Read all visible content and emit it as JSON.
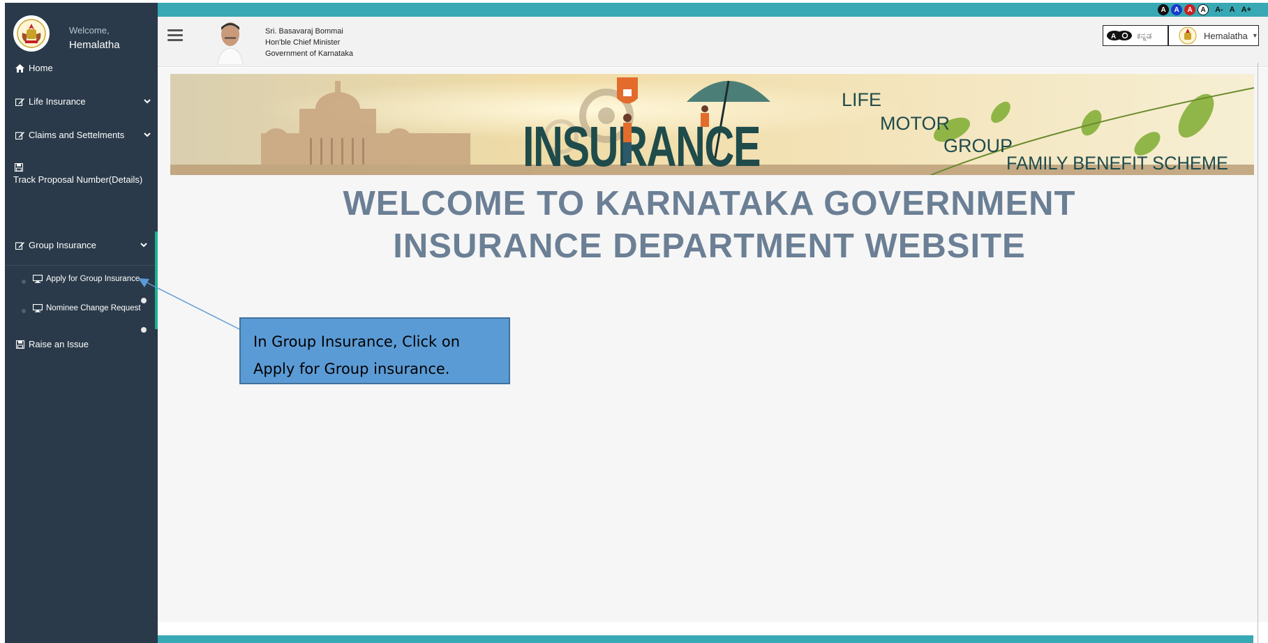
{
  "sidebar": {
    "welcome": "Welcome,",
    "username": "Hemalatha",
    "items": [
      {
        "label": "Home"
      },
      {
        "label": "Life Insurance"
      },
      {
        "label": "Claims and Settelments"
      },
      {
        "label": "Track Proposal Number(Details)"
      },
      {
        "label": "Group Insurance"
      },
      {
        "label": "Raise an Issue"
      }
    ],
    "group_sub": [
      {
        "label": "Apply for Group Insurance"
      },
      {
        "label": "Nominee Change Request"
      }
    ]
  },
  "header": {
    "cm_name": "Sri. Basavaraj Bommai",
    "cm_title": "Hon'ble Chief Minister",
    "cm_gov": "Government of Karnataka",
    "access": [
      "A",
      "A",
      "A",
      "A"
    ],
    "font_sizes": [
      "A-",
      "A",
      "A+"
    ],
    "language": "ಕನ್ನಡ",
    "user": "Hemalatha"
  },
  "banner": {
    "main_word": "INSURANCE",
    "life": "LIFE",
    "motor": "MOTOR",
    "group": "GROUP",
    "family": "FAMILY BENEFIT SCHEME"
  },
  "main": {
    "title_line1": "WELCOME TO KARNATAKA GOVERNMENT",
    "title_line2": "INSURANCE DEPARTMENT WEBSITE"
  },
  "callout": {
    "line1": "In Group Insurance, Click on",
    "line2": "Apply for Group insurance."
  },
  "colors": {
    "sidebar": "#2a3a4a",
    "teal": "#38a9b4",
    "accent_green": "#1ab394",
    "title": "#6b7f95",
    "callout": "#5b9bd5"
  }
}
